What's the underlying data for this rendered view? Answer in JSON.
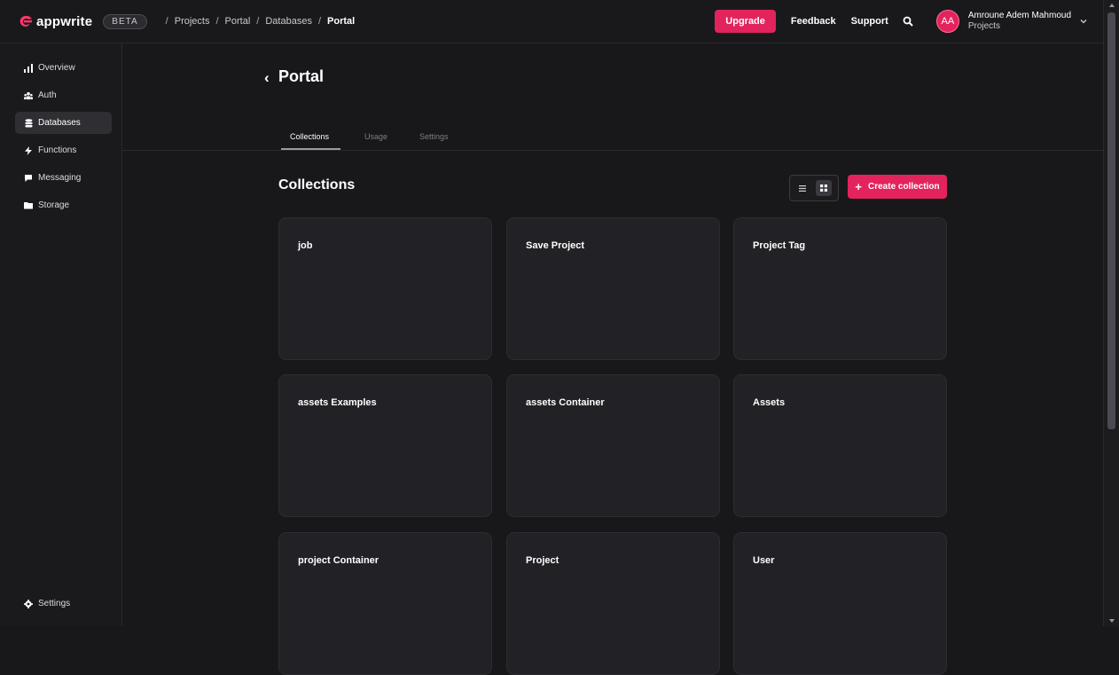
{
  "brand": {
    "name": "appwrite",
    "badge": "BETA"
  },
  "breadcrumbs": [
    "Projects",
    "Portal",
    "Databases",
    "Portal"
  ],
  "header": {
    "upgrade_label": "Upgrade",
    "feedback_label": "Feedback",
    "support_label": "Support",
    "user": {
      "initials": "AA",
      "name": "Amroune Adem Mahmoud",
      "sub": "Projects"
    }
  },
  "sidebar": {
    "items": [
      {
        "label": "Overview",
        "icon": "bar-chart-icon"
      },
      {
        "label": "Auth",
        "icon": "users-icon"
      },
      {
        "label": "Databases",
        "icon": "database-icon",
        "active": true
      },
      {
        "label": "Functions",
        "icon": "lightning-icon"
      },
      {
        "label": "Messaging",
        "icon": "message-icon"
      },
      {
        "label": "Storage",
        "icon": "folder-icon"
      }
    ],
    "settings_label": "Settings"
  },
  "page": {
    "title": "Portal",
    "tabs": [
      "Collections",
      "Usage",
      "Settings"
    ],
    "active_tab": "Collections",
    "section_title": "Collections",
    "create_label": "Create collection",
    "view_mode": "grid"
  },
  "collections": [
    "job",
    "Save Project",
    "Project Tag",
    "assets Examples",
    "assets Container",
    "Assets",
    "project Container",
    "Project",
    "User"
  ],
  "colors": {
    "accent": "#e3235c",
    "background": "#18181b",
    "card": "#222226"
  }
}
